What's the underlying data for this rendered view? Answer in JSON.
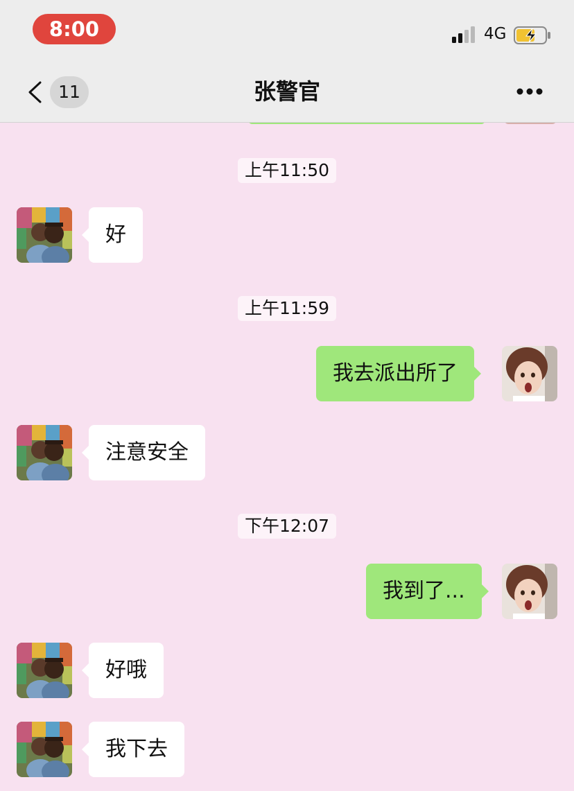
{
  "status_bar": {
    "time": "8:00",
    "network": "4G",
    "signal_bars": 2,
    "battery_charging": true
  },
  "nav": {
    "unread_count": "11",
    "title": "张警官",
    "back_icon": "chevron-left-icon",
    "more_icon": "more-dots-icon"
  },
  "colors": {
    "chat_background": "#f8e1f0",
    "outgoing_bubble": "#9fe77b",
    "incoming_bubble": "#ffffff",
    "time_pill": "#e0453d"
  },
  "messages": [
    {
      "type": "timestamp",
      "text": "上午11:50"
    },
    {
      "type": "incoming",
      "text": "好"
    },
    {
      "type": "timestamp",
      "text": "上午11:59"
    },
    {
      "type": "outgoing",
      "text": "我去派出所了"
    },
    {
      "type": "incoming",
      "text": "注意安全"
    },
    {
      "type": "timestamp",
      "text": "下午12:07"
    },
    {
      "type": "outgoing",
      "text": "我到了..."
    },
    {
      "type": "incoming",
      "text": "好哦"
    },
    {
      "type": "incoming",
      "text": "我下去"
    }
  ]
}
